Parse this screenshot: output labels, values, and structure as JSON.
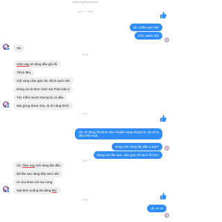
{
  "header": {
    "status": "Hoạt động 8 phút trước"
  },
  "timestamps": [
    "03:07, 7 TH8 8",
    "03:16",
    "04:01",
    "04:07",
    "03:59"
  ],
  "messages_out_1": [
    "Uh, chiều qua nhé",
    "Chủ mạnh nhé"
  ],
  "messages_in_1": [
    "Ok"
  ],
  "messages_in_2": [
    [
      "Hôm nay",
      " tớ dùng dầu gội rồi"
    ],
    "Thích lắm,",
    "Gội xong cảm giác tóc rất là sạch nhé",
    "Dùng cả xả theo cách mà Thảo bảo ý",
    "Tóc mềm mượt nhưng ko có dầu",
    "Mùi gừng thơm nhẹ, ck tớ cũng thích"
  ],
  "messages_out_2": [
    "Uh, tớ dùng rồi thích nên chuyển sang dùng lun, bỏ xổ lo",
    "dầu mới mua",
    "Hnay mới dùng lần đầu à bạn?",
    "Dùng các lần sau, cảm giác sẽ sạch rồi hơn"
  ],
  "messages_in_3": [
    [
      "Uh, ",
      "hôm nay",
      " mới dùng lần đầu"
    ],
    "Để lần sau dùng tiếp xem nên",
    "Hi vừa khoe với mẹ xong",
    [
      "Mai đem xuống bà dùng ",
      "thử"
    ]
  ],
  "messages_out_3": [
    "Uh, Hi Hi"
  ],
  "colors": {
    "outgoing": "#2f8df5",
    "incoming": "#efefef",
    "like": "#2f8df5"
  },
  "icons": [
    "avatar",
    "like-thumb-icon",
    "seen-avatar-icon"
  ]
}
